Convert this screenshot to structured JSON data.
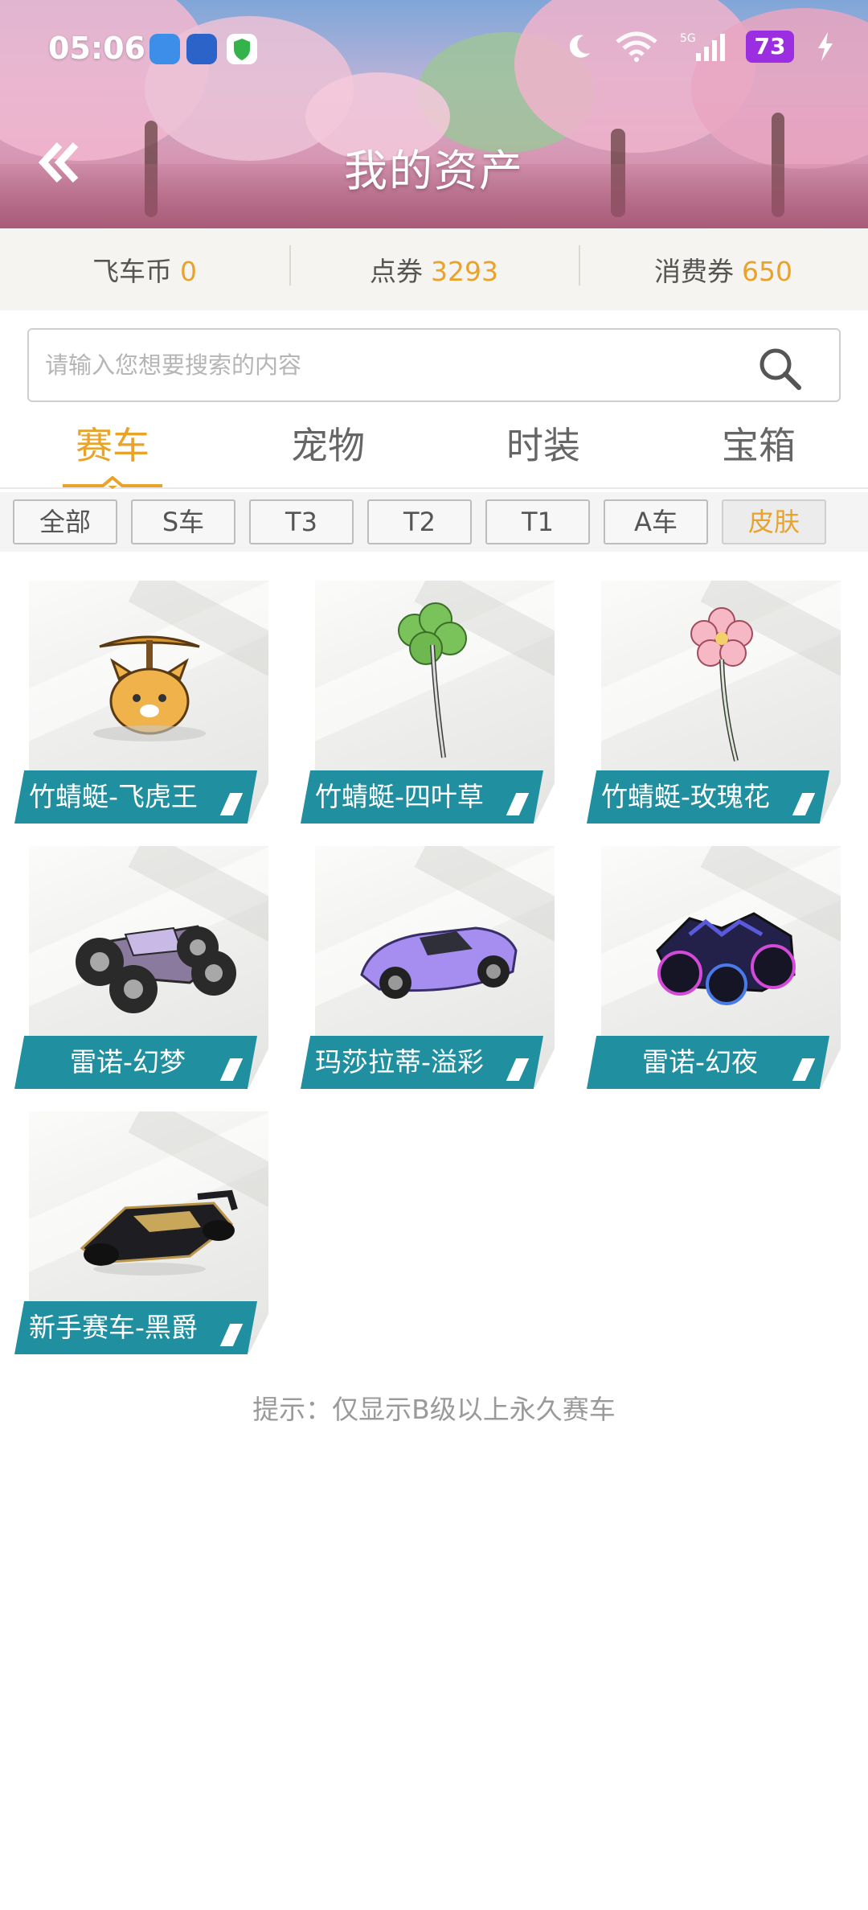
{
  "status_bar": {
    "time": "05:06",
    "network": "5G",
    "battery": "73"
  },
  "header": {
    "title": "我的资产"
  },
  "currencies": [
    {
      "label": "飞车币",
      "value": "0"
    },
    {
      "label": "点券",
      "value": "3293"
    },
    {
      "label": "消费券",
      "value": "650"
    }
  ],
  "search": {
    "placeholder": "请输入您想要搜索的内容"
  },
  "tabs": [
    {
      "label": "赛车",
      "active": true
    },
    {
      "label": "宠物",
      "active": false
    },
    {
      "label": "时装",
      "active": false
    },
    {
      "label": "宝箱",
      "active": false
    }
  ],
  "filters": [
    {
      "label": "全部",
      "selected": false
    },
    {
      "label": "S车",
      "selected": false
    },
    {
      "label": "T3",
      "selected": false
    },
    {
      "label": "T2",
      "selected": false
    },
    {
      "label": "T1",
      "selected": false
    },
    {
      "label": "A车",
      "selected": false
    },
    {
      "label": "皮肤",
      "selected": true
    }
  ],
  "items": [
    {
      "name": "竹蜻蜓-飞虎王",
      "icon": "tiger-propeller-icon"
    },
    {
      "name": "竹蜻蜓-四叶草",
      "icon": "clover-propeller-icon"
    },
    {
      "name": "竹蜻蜓-玫瑰花",
      "icon": "flower-propeller-icon"
    },
    {
      "name": "雷诺-幻梦",
      "icon": "buggy-car-icon"
    },
    {
      "name": "玛莎拉蒂-溢彩",
      "icon": "sports-car-icon"
    },
    {
      "name": "雷诺-幻夜",
      "icon": "armored-car-icon"
    },
    {
      "name": "新手赛车-黑爵",
      "icon": "kart-car-icon"
    }
  ],
  "hint": "提示：仅显示B级以上永久赛车",
  "colors": {
    "accent": "#e9a22a",
    "label_bg": "#208fa0",
    "battery": "#9b2ee0"
  }
}
